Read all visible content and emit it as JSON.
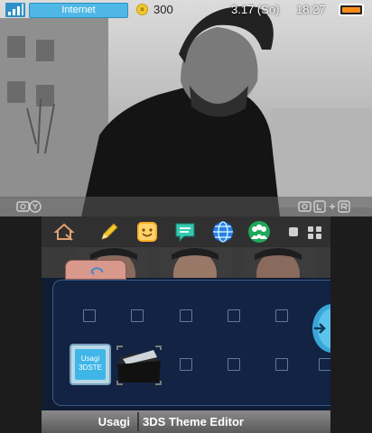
{
  "status_bar": {
    "network_label": "Internet",
    "coins": "300",
    "date": "3.17 (So)",
    "time": "18:27"
  },
  "home_menu": {
    "selected_title": "Usagi",
    "selected_subtitle": "3DS Theme Editor",
    "selected_icon_text_line1": "Usagi",
    "selected_icon_text_line2": "3DSTE"
  },
  "colors": {
    "internet_pill": "#4fb7e6",
    "battery": "#ff8c1a",
    "panel": "#122343"
  }
}
